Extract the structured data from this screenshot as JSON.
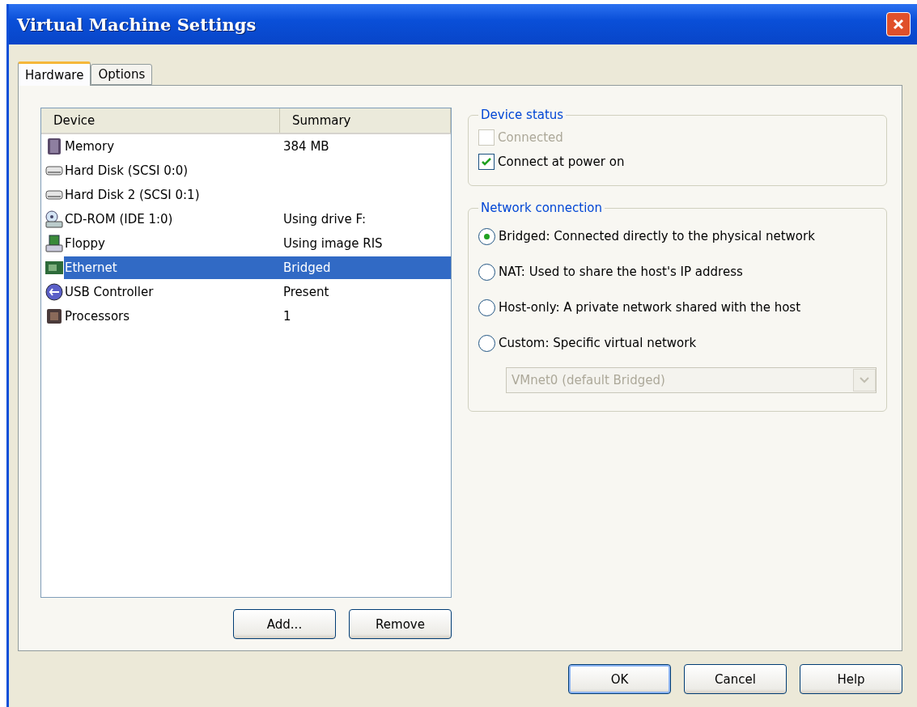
{
  "window": {
    "title": "Virtual Machine Settings"
  },
  "tabs": [
    {
      "label": "Hardware",
      "selected": true
    },
    {
      "label": "Options",
      "selected": false
    }
  ],
  "device_list": {
    "columns": [
      "Device",
      "Summary"
    ],
    "rows": [
      {
        "kind": "memory",
        "device": "Memory",
        "summary": "384 MB",
        "selected": false
      },
      {
        "kind": "disk",
        "device": "Hard Disk (SCSI 0:0)",
        "selected": false
      },
      {
        "kind": "disk",
        "device": "Hard Disk 2 (SCSI 0:1)",
        "selected": false
      },
      {
        "kind": "cdrom",
        "device": "CD-ROM (IDE 1:0)",
        "summary": "Using drive F:",
        "selected": false
      },
      {
        "kind": "floppy",
        "device": "Floppy",
        "summary": "Using image RIS",
        "selected": false
      },
      {
        "kind": "ethernet",
        "device": "Ethernet",
        "summary": "Bridged",
        "selected": true
      },
      {
        "kind": "usb",
        "device": "USB Controller",
        "summary": "Present",
        "selected": false
      },
      {
        "kind": "cpu",
        "device": "Processors",
        "summary": "1",
        "selected": false
      }
    ]
  },
  "list_buttons": [
    "Add...",
    "Remove"
  ],
  "device_status": {
    "title": "Device status",
    "options": [
      {
        "label": "Connected",
        "checked": false,
        "disabled": true
      },
      {
        "label": "Connect at power on",
        "checked": true,
        "disabled": false
      }
    ]
  },
  "network_connection": {
    "title": "Network connection",
    "options": [
      {
        "label": "Bridged: Connected directly to the physical network",
        "selected": true
      },
      {
        "label": "NAT: Used to share the host's IP address",
        "selected": false
      },
      {
        "label": "Host-only: A private network shared with the host",
        "selected": false
      },
      {
        "label": "Custom: Specific virtual network",
        "selected": false
      }
    ],
    "network_select": {
      "value": "VMnet0 (default Bridged)",
      "disabled": true
    }
  },
  "dialog_buttons": [
    {
      "label": "OK",
      "default": true
    },
    {
      "label": "Cancel",
      "default": false
    },
    {
      "label": "Help",
      "default": false
    }
  ]
}
